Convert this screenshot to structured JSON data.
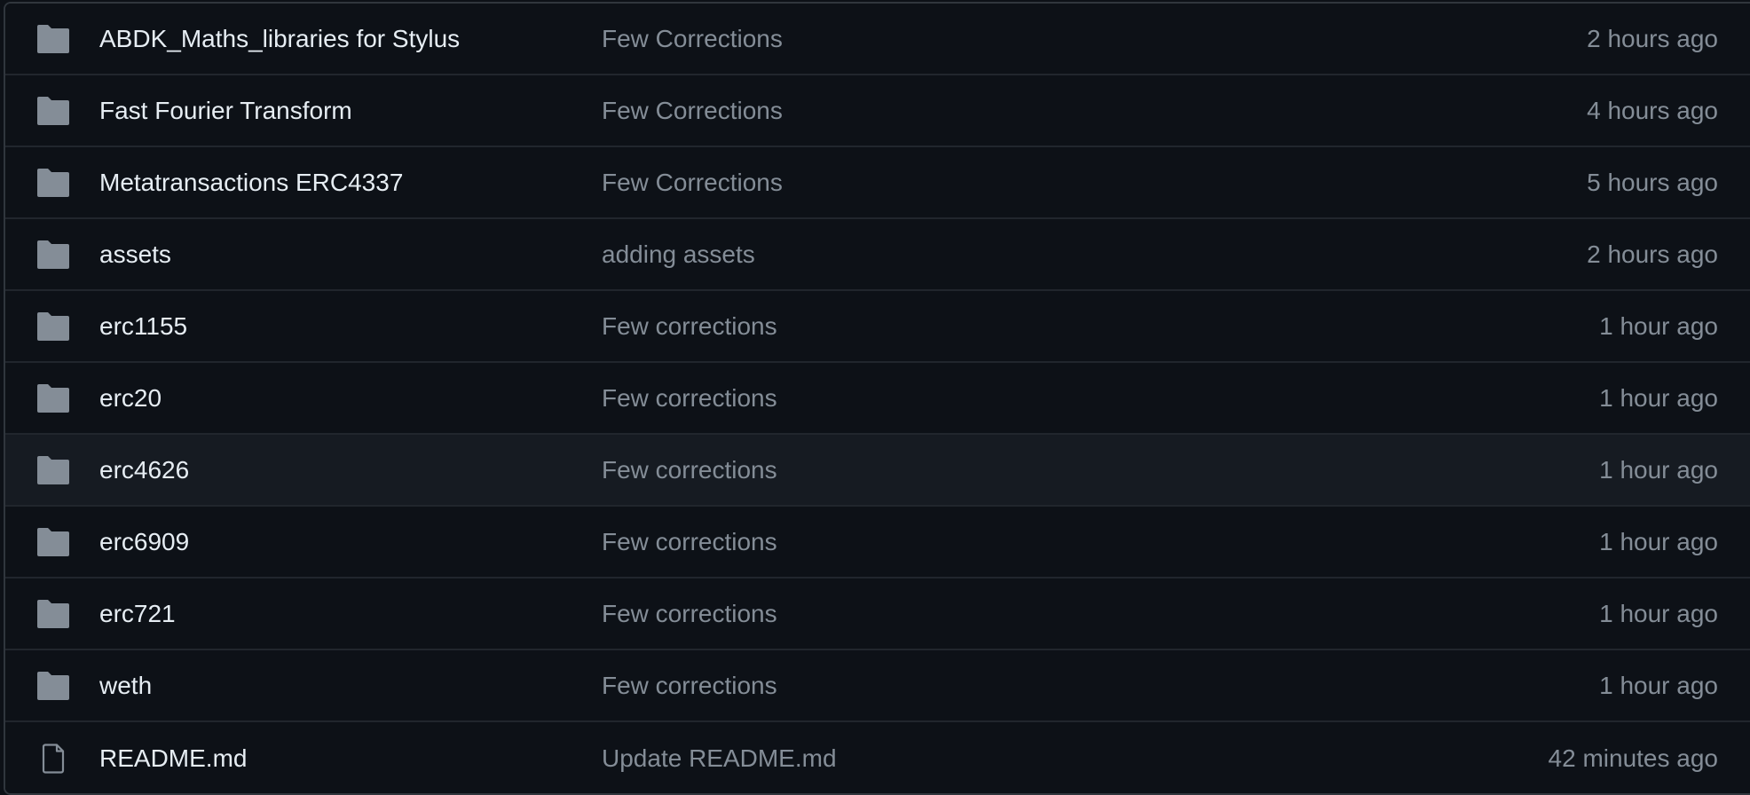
{
  "colors": {
    "background": "#0d1117",
    "row_highlight": "#161b22",
    "border": "#21262d",
    "name": "#e6edf3",
    "muted": "#848d97"
  },
  "files": [
    {
      "type": "folder",
      "icon": "folder-icon",
      "name": "ABDK_Maths_libraries for Stylus",
      "message": "Few Corrections",
      "date": "2 hours ago"
    },
    {
      "type": "folder",
      "icon": "folder-icon",
      "name": "Fast Fourier Transform",
      "message": "Few Corrections",
      "date": "4 hours ago"
    },
    {
      "type": "folder",
      "icon": "folder-icon",
      "name": "Metatransactions ERC4337",
      "message": "Few Corrections",
      "date": "5 hours ago"
    },
    {
      "type": "folder",
      "icon": "folder-icon",
      "name": "assets",
      "message": "adding assets",
      "date": "2 hours ago"
    },
    {
      "type": "folder",
      "icon": "folder-icon",
      "name": "erc1155",
      "message": "Few corrections",
      "date": "1 hour ago"
    },
    {
      "type": "folder",
      "icon": "folder-icon",
      "name": "erc20",
      "message": "Few corrections",
      "date": "1 hour ago"
    },
    {
      "type": "folder",
      "icon": "folder-icon",
      "name": "erc4626",
      "message": "Few corrections",
      "date": "1 hour ago",
      "highlighted": true
    },
    {
      "type": "folder",
      "icon": "folder-icon",
      "name": "erc6909",
      "message": "Few corrections",
      "date": "1 hour ago"
    },
    {
      "type": "folder",
      "icon": "folder-icon",
      "name": "erc721",
      "message": "Few corrections",
      "date": "1 hour ago"
    },
    {
      "type": "folder",
      "icon": "folder-icon",
      "name": "weth",
      "message": "Few corrections",
      "date": "1 hour ago"
    },
    {
      "type": "file",
      "icon": "file-icon",
      "name": "README.md",
      "message": "Update README.md",
      "date": "42 minutes ago"
    }
  ]
}
